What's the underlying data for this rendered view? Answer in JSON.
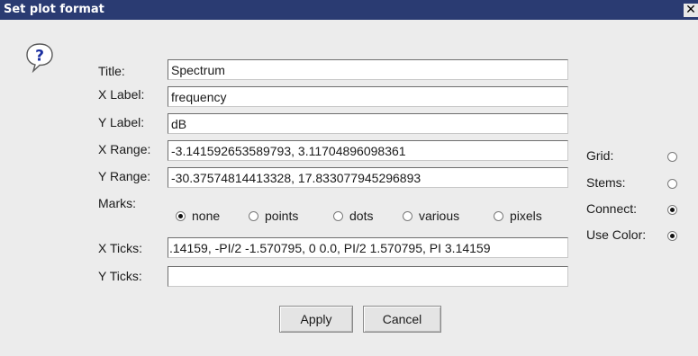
{
  "window": {
    "title": "Set plot format",
    "close_glyph": "✕"
  },
  "icon": {
    "name": "question-icon",
    "glyph": "?",
    "accent": "#1b2fa0"
  },
  "fields": {
    "title": {
      "label": "Title:",
      "value": "Spectrum"
    },
    "xlabel": {
      "label": "X Label:",
      "value": "frequency"
    },
    "ylabel": {
      "label": "Y Label:",
      "value": "dB"
    },
    "xrange": {
      "label": "X Range:",
      "value": "-3.141592653589793, 3.11704896098361"
    },
    "yrange": {
      "label": "Y Range:",
      "value": "-30.37574814413328, 17.833077945296893"
    },
    "xticks": {
      "label": "X Ticks:",
      "value": ".14159, -PI/2 -1.570795, 0 0.0, PI/2 1.570795, PI 3.14159"
    },
    "yticks": {
      "label": "Y Ticks:",
      "value": ""
    }
  },
  "marks": {
    "label": "Marks:",
    "options": [
      "none",
      "points",
      "dots",
      "various",
      "pixels"
    ],
    "selected": "none"
  },
  "options": {
    "grid": {
      "label": "Grid:",
      "checked": false
    },
    "stems": {
      "label": "Stems:",
      "checked": false
    },
    "connect": {
      "label": "Connect:",
      "checked": true
    },
    "usecolor": {
      "label": "Use Color:",
      "checked": true
    }
  },
  "buttons": {
    "apply": "Apply",
    "cancel": "Cancel"
  }
}
